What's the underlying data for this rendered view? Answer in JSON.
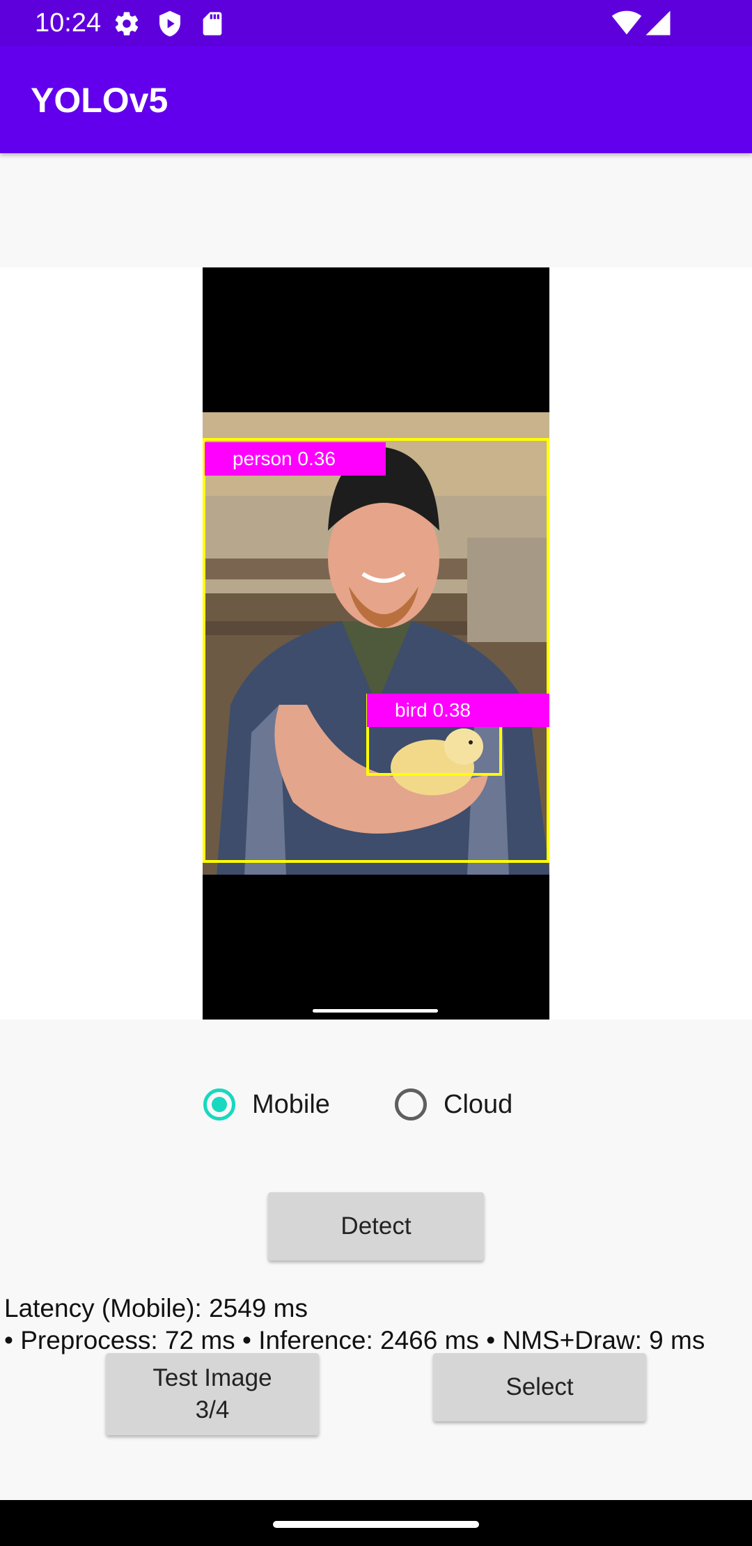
{
  "status_bar": {
    "time": "10:24",
    "icons": [
      "gear-icon",
      "shield-icon",
      "sd-card-icon",
      "wifi-icon",
      "cellular-signal-icon"
    ]
  },
  "app_bar": {
    "title": "YOLOv5",
    "color": "#6200ee"
  },
  "detections": [
    {
      "label": "person 0.36",
      "class": "person",
      "score": 0.36
    },
    {
      "label": "bird 0.38",
      "class": "bird",
      "score": 0.38
    }
  ],
  "detection_colors": {
    "box": "#ffff00",
    "label_bg": "#ff00ff"
  },
  "mode": {
    "options": [
      {
        "label": "Mobile",
        "checked": true
      },
      {
        "label": "Cloud",
        "checked": false
      }
    ],
    "accent": "#18d8c0"
  },
  "buttons": {
    "detect": "Detect",
    "test_image_line1": "Test Image",
    "test_image_line2": "3/4",
    "select": "Select"
  },
  "results": {
    "latency": "Latency (Mobile): 2549 ms",
    "timing": "• Preprocess: 72 ms  • Inference: 2466 ms  • NMS+Draw: 9 ms"
  }
}
